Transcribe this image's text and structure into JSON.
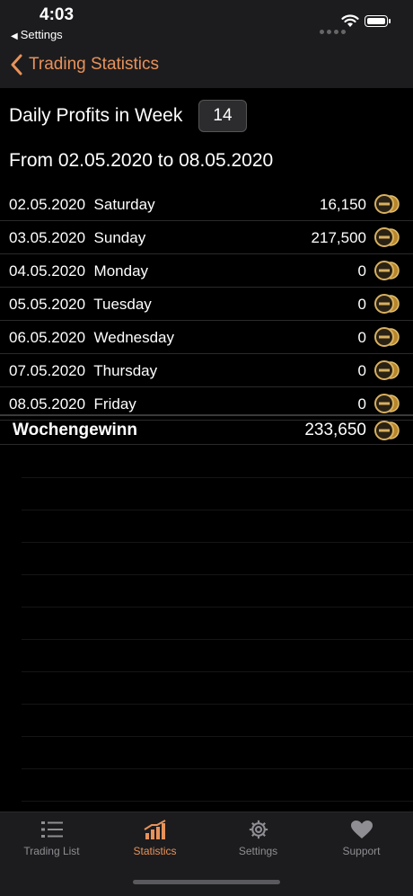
{
  "status_bar": {
    "time": "4:03",
    "back_app": "Settings"
  },
  "nav": {
    "back_label": "Trading Statistics"
  },
  "header": {
    "week_title": "Daily Profits in Week",
    "week_number": "14",
    "range_title": "From 02.05.2020 to 08.05.2020"
  },
  "days": [
    {
      "date": "02.05.2020",
      "day": "Saturday",
      "value": "16,150"
    },
    {
      "date": "03.05.2020",
      "day": "Sunday",
      "value": "217,500"
    },
    {
      "date": "04.05.2020",
      "day": "Monday",
      "value": "0"
    },
    {
      "date": "05.05.2020",
      "day": "Tuesday",
      "value": "0"
    },
    {
      "date": "06.05.2020",
      "day": "Wednesday",
      "value": "0"
    },
    {
      "date": "07.05.2020",
      "day": "Thursday",
      "value": "0"
    },
    {
      "date": "08.05.2020",
      "day": "Friday",
      "value": "0"
    }
  ],
  "total": {
    "label": "Wochengewinn",
    "value": "233,650"
  },
  "tabs": [
    {
      "label": "Trading List",
      "icon": "list-icon",
      "active": false
    },
    {
      "label": "Statistics",
      "icon": "chart-icon",
      "active": true
    },
    {
      "label": "Settings",
      "icon": "gear-icon",
      "active": false
    },
    {
      "label": "Support",
      "icon": "heart-icon",
      "active": false
    }
  ],
  "colors": {
    "accent": "#e8925a",
    "background": "#000000",
    "bar": "#1c1c1e",
    "inactive": "#8e8e93"
  }
}
